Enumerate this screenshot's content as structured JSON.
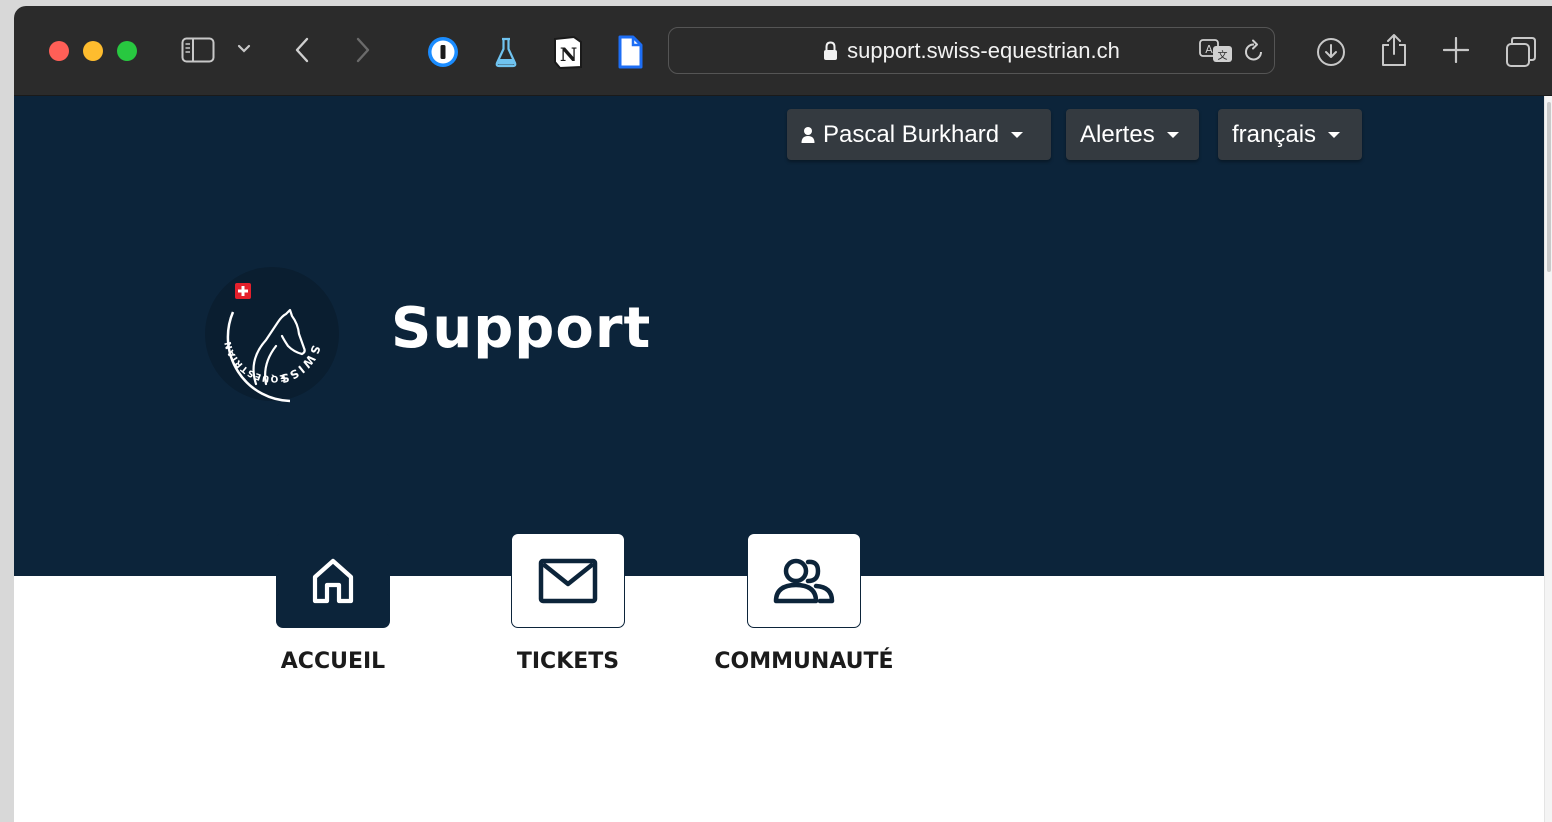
{
  "browser": {
    "url": "support.swiss-equestrian.ch",
    "icons": [
      "sidebar-toggle-icon",
      "chevron-down-icon",
      "back-arrow-icon",
      "forward-arrow-icon",
      "onepassword-icon",
      "flask-icon",
      "notion-icon",
      "document-icon",
      "lock-icon",
      "translate-icon",
      "reload-icon",
      "download-icon",
      "share-icon",
      "new-tab-icon",
      "tabs-overview-icon"
    ]
  },
  "header": {
    "user_menu_label": "Pascal Burkhard",
    "alerts_label": "Alertes",
    "language_label": "français"
  },
  "brand": {
    "logo_text_1": "SWISS",
    "logo_text_2": "EQUESTRIAN",
    "title": "Support"
  },
  "nav": [
    {
      "label": "ACCUEIL",
      "icon": "home-icon",
      "active": true
    },
    {
      "label": "TICKETS",
      "icon": "envelope-icon",
      "active": false
    },
    {
      "label": "COMMUNAUTÉ",
      "icon": "users-icon",
      "active": false
    }
  ],
  "colors": {
    "hero_background": "#0c243a",
    "dropdown_background": "#343a40",
    "toolbar": "#2b2b2b"
  }
}
